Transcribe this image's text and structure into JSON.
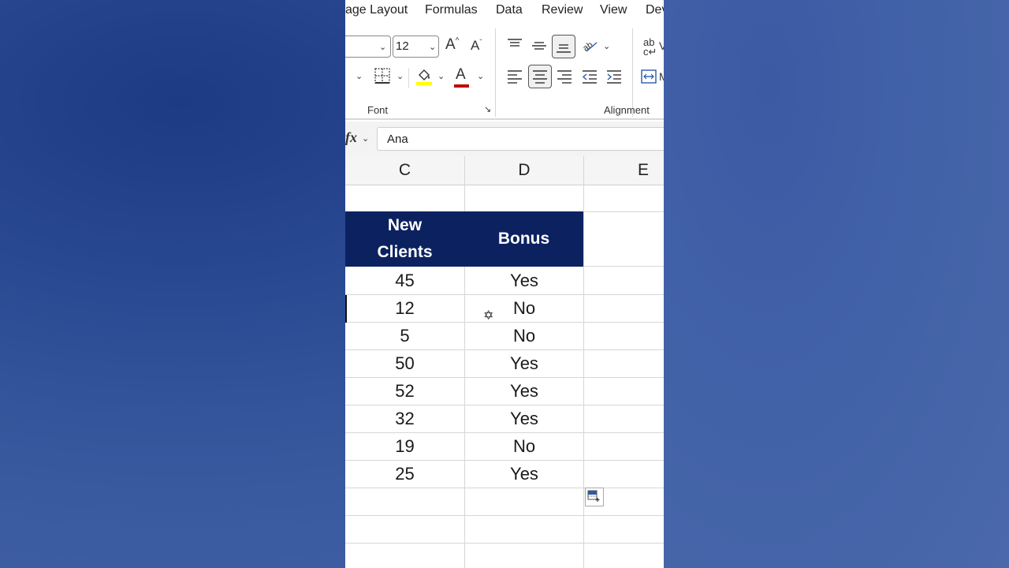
{
  "tabs": [
    "age Layout",
    "Formulas",
    "Data",
    "Review",
    "View",
    "Dev"
  ],
  "ribbon": {
    "font_name_value": "",
    "font_size_value": "12",
    "font_group_label": "Font",
    "alignment_group_label": "Alignment",
    "grow_font_glyph": "A",
    "shrink_font_glyph": "A",
    "font_color_glyph": "A",
    "font_color": "#c00000",
    "highlight_color": "#ffff00"
  },
  "formula_bar": {
    "fx_label": "fx",
    "value": "Ana"
  },
  "columns": [
    "C",
    "D",
    "E"
  ],
  "table": {
    "headers": [
      "New\nClients",
      "Bonus"
    ],
    "rows": [
      [
        "45",
        "Yes"
      ],
      [
        "12",
        "No"
      ],
      [
        "5",
        "No"
      ],
      [
        "50",
        "Yes"
      ],
      [
        "52",
        "Yes"
      ],
      [
        "32",
        "Yes"
      ],
      [
        "19",
        "No"
      ],
      [
        "25",
        "Yes"
      ]
    ]
  },
  "colors": {
    "header_fill": "#0c2260",
    "header_text": "#ffffff"
  }
}
